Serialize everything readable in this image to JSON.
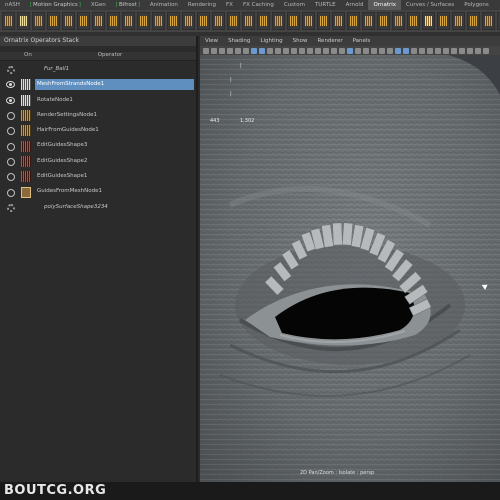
{
  "shelf_tabs": [
    {
      "label": "nASH",
      "bracketed": false,
      "active": false
    },
    {
      "label": "Motion Graphics",
      "bracketed": true,
      "active": false
    },
    {
      "label": "XGen",
      "bracketed": false,
      "active": false
    },
    {
      "label": "Bifrost",
      "bracketed": true,
      "active": false
    },
    {
      "label": "Animation",
      "bracketed": false,
      "active": false
    },
    {
      "label": "Rendering",
      "bracketed": false,
      "active": false
    },
    {
      "label": "FX",
      "bracketed": false,
      "active": false
    },
    {
      "label": "FX Caching",
      "bracketed": false,
      "active": false
    },
    {
      "label": "Custom",
      "bracketed": false,
      "active": false
    },
    {
      "label": "TURTLE",
      "bracketed": false,
      "active": false
    },
    {
      "label": "Arnold",
      "bracketed": false,
      "active": false
    },
    {
      "label": "Ornatrix",
      "bracketed": false,
      "active": true
    },
    {
      "label": "Curves / Surfaces",
      "bracketed": false,
      "active": false
    },
    {
      "label": "Polygons",
      "bracketed": false,
      "active": false
    }
  ],
  "operators_panel": {
    "title": "Ornatrix Operators Stack",
    "col_on": "On",
    "col_operator": "Operator",
    "rows": [
      {
        "name": "Fur_Ball1",
        "on_icon": "gear",
        "icon": "none",
        "italic": true,
        "selected": false
      },
      {
        "name": "MeshFromStrandsNode1",
        "on_icon": "eye",
        "icon": "hair-white",
        "italic": false,
        "selected": true
      },
      {
        "name": "RotateNode1",
        "on_icon": "eye",
        "icon": "hair-white",
        "italic": false,
        "selected": false
      },
      {
        "name": "RenderSettingsNode1",
        "on_icon": "ring",
        "icon": "hair-gold",
        "italic": false,
        "selected": false
      },
      {
        "name": "HairFromGuidesNode1",
        "on_icon": "ring",
        "icon": "hair-gold",
        "italic": false,
        "selected": false
      },
      {
        "name": "EditGuidesShape3",
        "on_icon": "ring",
        "icon": "hair-red",
        "italic": false,
        "selected": false
      },
      {
        "name": "EditGuidesShape2",
        "on_icon": "ring",
        "icon": "hair-red",
        "italic": false,
        "selected": false
      },
      {
        "name": "EditGuidesShape1",
        "on_icon": "ring",
        "icon": "hair-red",
        "italic": false,
        "selected": false
      },
      {
        "name": "GuidesFromMeshNode1",
        "on_icon": "ring",
        "icon": "hair-box",
        "italic": false,
        "selected": false
      },
      {
        "name": "polySurfaceShape3234",
        "on_icon": "gear",
        "icon": "none",
        "italic": true,
        "selected": false
      }
    ]
  },
  "viewport": {
    "menu": [
      "View",
      "Shading",
      "Lighting",
      "Show",
      "Renderer",
      "Panels"
    ],
    "hud_values": [
      "443",
      "1,302"
    ],
    "camera_label": "2D Pan/Zoom : Isolate : persp"
  },
  "watermark": {
    "text": "BOUTCG.ORG"
  },
  "colors": {
    "selection": "#5f8fbf",
    "accent_bracket": "#39b54a",
    "skin": "#6b7073"
  }
}
